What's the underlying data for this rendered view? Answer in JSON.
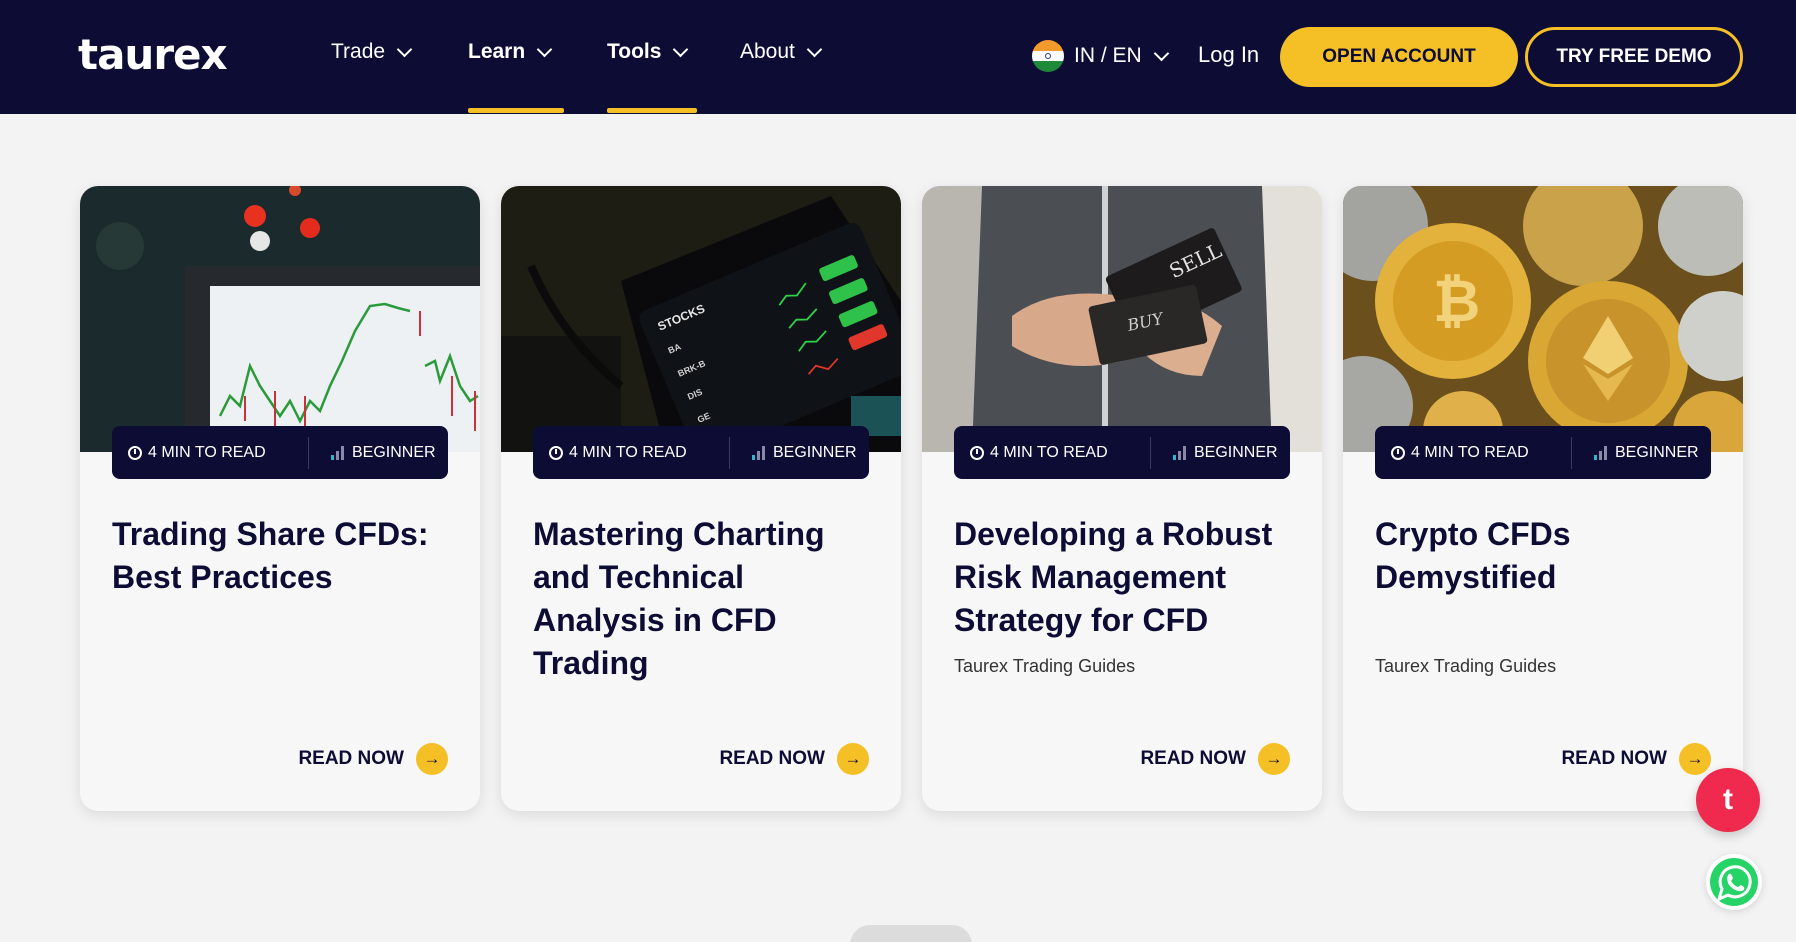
{
  "brand": {
    "logo": "taurex"
  },
  "nav": {
    "items": [
      {
        "label": "Trade"
      },
      {
        "label": "Learn"
      },
      {
        "label": "Tools"
      },
      {
        "label": "About"
      }
    ],
    "language": "IN / EN",
    "login": "Log In",
    "open_account": "OPEN ACCOUNT",
    "try_demo": "TRY FREE DEMO"
  },
  "cards": [
    {
      "read_time": "4 MIN TO READ",
      "level": "BEGINNER",
      "title": "Trading Share CFDs: Best Practices",
      "subtitle": "",
      "cta": "READ NOW"
    },
    {
      "read_time": "4 MIN TO READ",
      "level": "BEGINNER",
      "title": "Mastering Charting and Technical Analysis in CFD Trading",
      "subtitle": "",
      "cta": "READ NOW"
    },
    {
      "read_time": "4 MIN TO READ",
      "level": "BEGINNER",
      "title": "Developing a Robust Risk Management Strategy for CFD",
      "subtitle": "Taurex Trading Guides",
      "cta": "READ NOW"
    },
    {
      "read_time": "4 MIN TO READ",
      "level": "BEGINNER",
      "title": "Crypto CFDs Demystified",
      "subtitle": "Taurex Trading Guides",
      "cta": "READ NOW"
    }
  ],
  "chat_badge": "t",
  "colors": {
    "navy": "#0d0c35",
    "accent": "#f5c026",
    "chat": "#ef2a4e",
    "whatsapp": "#25d366"
  }
}
